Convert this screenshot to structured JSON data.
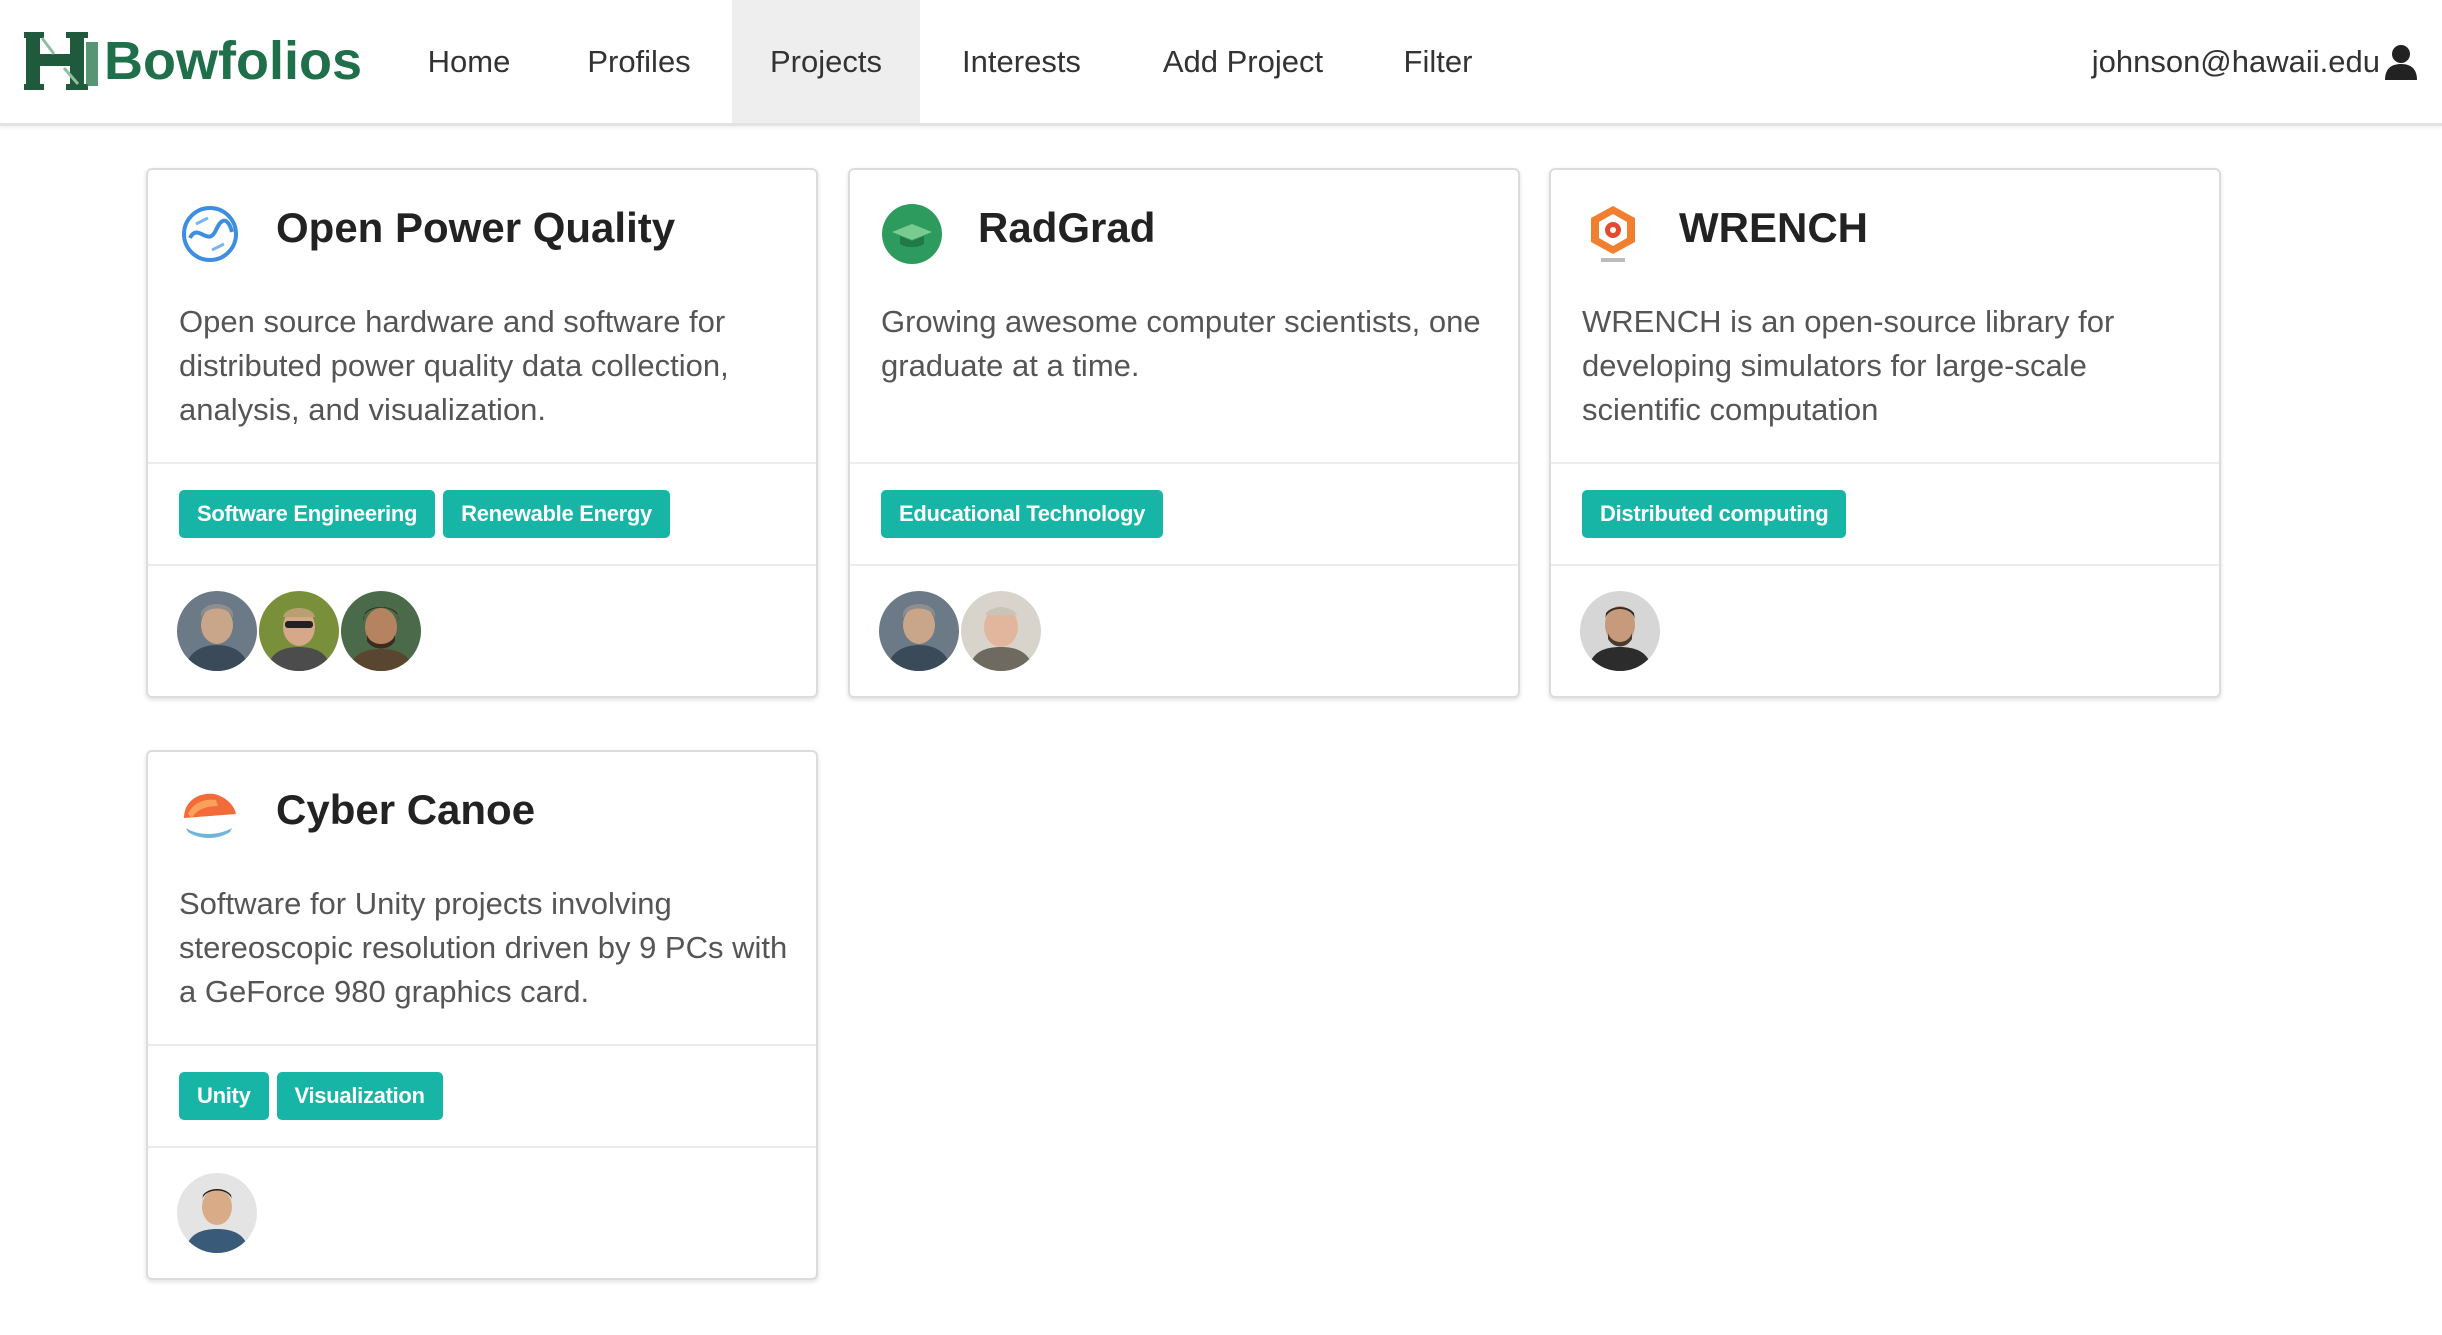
{
  "navbar": {
    "brand": "Bowfolios",
    "items": [
      {
        "label": "Home"
      },
      {
        "label": "Profiles"
      },
      {
        "label": "Projects",
        "active": true
      },
      {
        "label": "Interests"
      },
      {
        "label": "Add Project"
      },
      {
        "label": "Filter"
      }
    ],
    "user": "johnson@hawaii.edu"
  },
  "colors": {
    "brand": "#1f6f4a",
    "tag": "#16b5a6",
    "active_nav_bg": "#eeeeee"
  },
  "projects": [
    {
      "title": "Open Power Quality",
      "icon": "open-power-quality-logo",
      "description": "Open source hardware and software for distributed power quality data collection, analysis, and visualization.",
      "tags": [
        "Software Engineering",
        "Renewable Energy"
      ],
      "members": 3
    },
    {
      "title": "RadGrad",
      "icon": "radgrad-logo",
      "description": "Growing awesome computer scientists, one graduate at a time.",
      "tags": [
        "Educational Technology"
      ],
      "members": 2
    },
    {
      "title": "WRENCH",
      "icon": "wrench-logo",
      "description": "WRENCH is an open-source library for developing simulators for large-scale scientific computation",
      "tags": [
        "Distributed computing"
      ],
      "members": 1
    },
    {
      "title": "Cyber Canoe",
      "icon": "cyber-canoe-logo",
      "description": "Software for Unity projects involving stereoscopic resolution driven by 9 PCs with a GeForce 980 graphics card.",
      "tags": [
        "Unity",
        "Visualization"
      ],
      "members": 1
    }
  ]
}
